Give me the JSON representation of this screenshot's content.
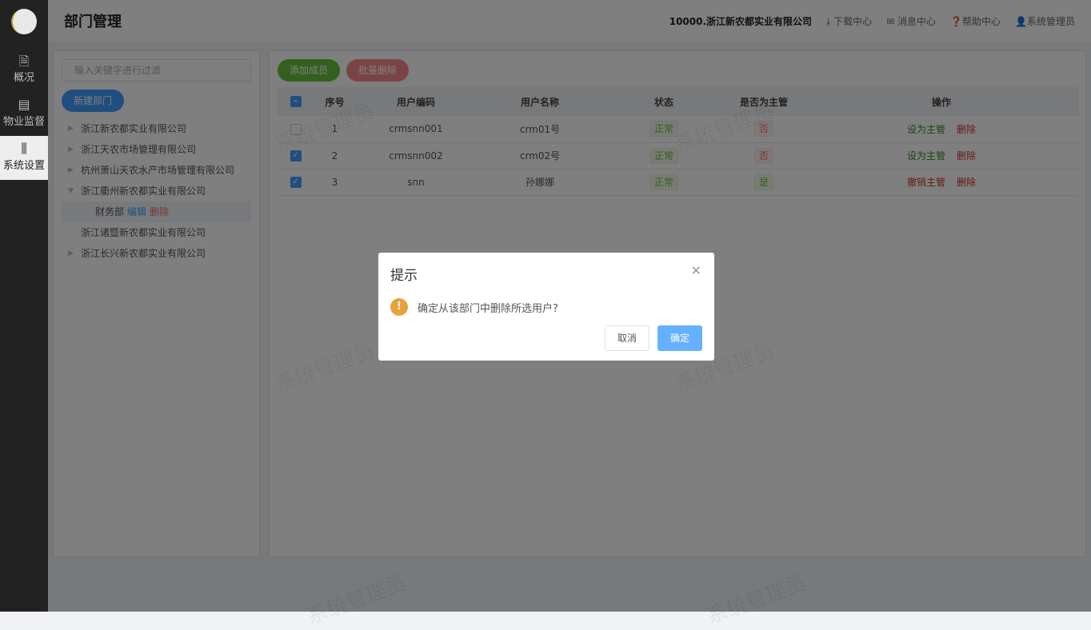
{
  "sidebar": {
    "items": [
      {
        "label": "概况",
        "icon": "document-icon"
      },
      {
        "label": "物业监督",
        "icon": "list-icon"
      },
      {
        "label": "系统设置",
        "icon": "sliders-icon"
      }
    ]
  },
  "header": {
    "title": "部门管理",
    "company": "10000.浙江新农都实业有限公司",
    "download": "下载中心",
    "messages": "消息中心",
    "help": "帮助中心",
    "user": "系统管理员"
  },
  "tree": {
    "placeholder": "输入关键字进行过滤",
    "new_button": "新建部门",
    "nodes": [
      "浙江新农都实业有限公司",
      "浙江天农市场管理有限公司",
      "杭州萧山天农水产市场管理有限公司",
      "浙江衢州新农都实业有限公司"
    ],
    "child": {
      "label": "财务部",
      "edit": "编辑",
      "delete": "删除"
    },
    "nodes2": [
      "浙江诸暨新农都实业有限公司",
      "浙江长兴新农都实业有限公司"
    ]
  },
  "toolbar": {
    "add": "添加成员",
    "batch_delete": "批量删除"
  },
  "table": {
    "headers": [
      "序号",
      "用户编码",
      "用户名称",
      "状态",
      "是否为主管",
      "操作"
    ],
    "rows": [
      {
        "no": "1",
        "code": "crmsnn001",
        "name": "crm01号",
        "status": "正常",
        "manager": "否",
        "op1": "设为主管",
        "op2": "删除",
        "checked": false
      },
      {
        "no": "2",
        "code": "crmsnn002",
        "name": "crm02号",
        "status": "正常",
        "manager": "否",
        "op1": "设为主管",
        "op2": "删除",
        "checked": true
      },
      {
        "no": "3",
        "code": "snn",
        "name": "孙娜娜",
        "status": "正常",
        "manager": "是",
        "op1": "撤销主管",
        "op2": "删除",
        "checked": true
      }
    ]
  },
  "watermark": "系统管理员",
  "dialog": {
    "title": "提示",
    "message": "确定从该部门中删除所选用户?",
    "cancel": "取消",
    "confirm": "确定"
  }
}
